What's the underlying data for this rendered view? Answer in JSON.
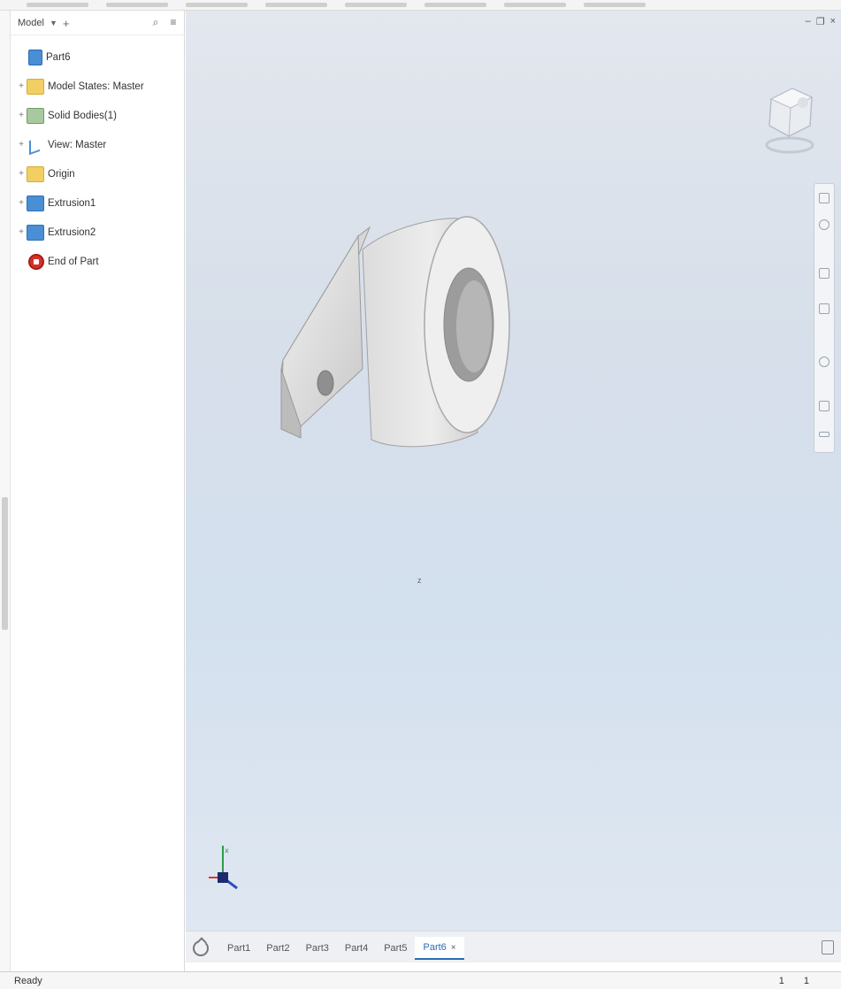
{
  "browser": {
    "title": "Model",
    "tree": [
      {
        "label": "Part6",
        "icon": "part-icon",
        "expandable": false
      },
      {
        "label": "Model States: Master",
        "icon": "folder-icon",
        "expandable": true
      },
      {
        "label": "Solid Bodies(1)",
        "icon": "solid-bodies-icon",
        "expandable": true
      },
      {
        "label": "View: Master",
        "icon": "view-icon",
        "expandable": true
      },
      {
        "label": "Origin",
        "icon": "folder-icon",
        "expandable": true
      },
      {
        "label": "Extrusion1",
        "icon": "extrusion-icon",
        "expandable": true
      },
      {
        "label": "Extrusion2",
        "icon": "extrusion-icon",
        "expandable": true
      },
      {
        "label": "End of Part",
        "icon": "end-of-part-icon",
        "expandable": false
      }
    ]
  },
  "viewport": {
    "cursor_label": "z",
    "triad_label": "x"
  },
  "doc_tabs": {
    "tabs": [
      "Part1",
      "Part2",
      "Part3",
      "Part4",
      "Part5",
      "Part6"
    ],
    "active_index": 5
  },
  "status": {
    "text": "Ready",
    "num1": "1",
    "num2": "1"
  },
  "colors": {
    "accent": "#2a6cb3",
    "viewport_top": "#e3e7ee",
    "viewport_bottom": "#dfe7f1"
  }
}
